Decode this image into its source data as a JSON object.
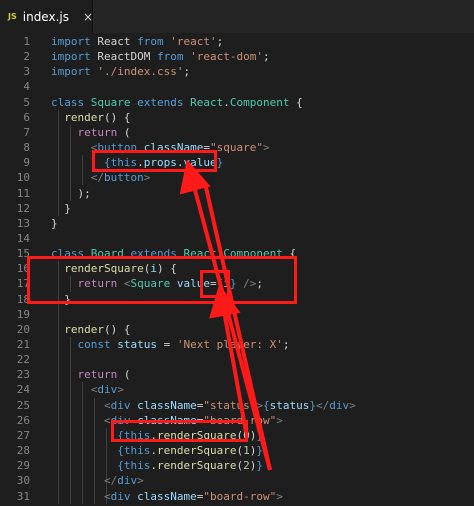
{
  "tab": {
    "icon": "JS",
    "filename": "index.js",
    "close": "×"
  },
  "colors": {
    "annotation": "#ff1a1a",
    "background": "#1e1e1e"
  },
  "lines": [
    {
      "n": "1",
      "tokens": [
        [
          "kw",
          "import "
        ],
        [
          "txt",
          "React "
        ],
        [
          "kw",
          "from "
        ],
        [
          "str",
          "'react'"
        ],
        [
          "txt",
          ";"
        ]
      ]
    },
    {
      "n": "2",
      "tokens": [
        [
          "kw",
          "import "
        ],
        [
          "txt",
          "ReactDOM "
        ],
        [
          "kw",
          "from "
        ],
        [
          "str",
          "'react-dom'"
        ],
        [
          "txt",
          ";"
        ]
      ]
    },
    {
      "n": "3",
      "tokens": [
        [
          "kw",
          "import "
        ],
        [
          "str",
          "'./index.css'"
        ],
        [
          "txt",
          ";"
        ]
      ]
    },
    {
      "n": "4",
      "tokens": []
    },
    {
      "n": "5",
      "tokens": [
        [
          "kw",
          "class "
        ],
        [
          "cls",
          "Square "
        ],
        [
          "kw",
          "extends "
        ],
        [
          "cls",
          "React"
        ],
        [
          "txt",
          "."
        ],
        [
          "cls",
          "Component "
        ],
        [
          "txt",
          "{"
        ]
      ]
    },
    {
      "n": "6",
      "tokens": [
        [
          "txt",
          "  "
        ],
        [
          "fn",
          "render"
        ],
        [
          "txt",
          "() {"
        ]
      ]
    },
    {
      "n": "7",
      "tokens": [
        [
          "txt",
          "    "
        ],
        [
          "ctl",
          "return "
        ],
        [
          "txt",
          "("
        ]
      ]
    },
    {
      "n": "8",
      "tokens": [
        [
          "txt",
          "      "
        ],
        [
          "punc",
          "<"
        ],
        [
          "tag",
          "button "
        ],
        [
          "attr",
          "className"
        ],
        [
          "txt",
          "="
        ],
        [
          "str",
          "\"square\""
        ],
        [
          "punc",
          ">"
        ]
      ]
    },
    {
      "n": "9",
      "tokens": [
        [
          "txt",
          "        "
        ],
        [
          "kw",
          "{"
        ],
        [
          "kw",
          "this"
        ],
        [
          "txt",
          "."
        ],
        [
          "var",
          "props"
        ],
        [
          "txt",
          "."
        ],
        [
          "var",
          "value"
        ],
        [
          "kw",
          "}"
        ]
      ]
    },
    {
      "n": "10",
      "tokens": [
        [
          "txt",
          "      "
        ],
        [
          "punc",
          "</"
        ],
        [
          "tag",
          "button"
        ],
        [
          "punc",
          ">"
        ]
      ]
    },
    {
      "n": "11",
      "tokens": [
        [
          "txt",
          "    );"
        ]
      ]
    },
    {
      "n": "12",
      "tokens": [
        [
          "txt",
          "  }"
        ]
      ]
    },
    {
      "n": "13",
      "tokens": [
        [
          "txt",
          "}"
        ]
      ]
    },
    {
      "n": "14",
      "tokens": []
    },
    {
      "n": "15",
      "tokens": [
        [
          "kw",
          "class "
        ],
        [
          "cls",
          "Board "
        ],
        [
          "kw",
          "extends "
        ],
        [
          "cls",
          "React"
        ],
        [
          "txt",
          "."
        ],
        [
          "cls",
          "Component "
        ],
        [
          "txt",
          "{"
        ]
      ]
    },
    {
      "n": "16",
      "tokens": [
        [
          "txt",
          "  "
        ],
        [
          "fn",
          "renderSquare"
        ],
        [
          "txt",
          "("
        ],
        [
          "var",
          "i"
        ],
        [
          "txt",
          ") {"
        ]
      ]
    },
    {
      "n": "17",
      "tokens": [
        [
          "txt",
          "    "
        ],
        [
          "ctl",
          "return "
        ],
        [
          "punc",
          "<"
        ],
        [
          "cls",
          "Square "
        ],
        [
          "attr",
          "value"
        ],
        [
          "txt",
          "="
        ],
        [
          "kw",
          "{"
        ],
        [
          "var",
          "i"
        ],
        [
          "kw",
          "}"
        ],
        [
          "punc",
          " />"
        ],
        [
          "txt",
          ";"
        ]
      ]
    },
    {
      "n": "18",
      "tokens": [
        [
          "txt",
          "  }"
        ]
      ]
    },
    {
      "n": "19",
      "tokens": []
    },
    {
      "n": "20",
      "tokens": [
        [
          "txt",
          "  "
        ],
        [
          "fn",
          "render"
        ],
        [
          "txt",
          "() {"
        ]
      ]
    },
    {
      "n": "21",
      "tokens": [
        [
          "txt",
          "    "
        ],
        [
          "kw",
          "const "
        ],
        [
          "var",
          "status "
        ],
        [
          "txt",
          "= "
        ],
        [
          "str",
          "'Next player: X'"
        ],
        [
          "txt",
          ";"
        ]
      ]
    },
    {
      "n": "22",
      "tokens": []
    },
    {
      "n": "23",
      "tokens": [
        [
          "txt",
          "    "
        ],
        [
          "ctl",
          "return "
        ],
        [
          "txt",
          "("
        ]
      ]
    },
    {
      "n": "24",
      "tokens": [
        [
          "txt",
          "      "
        ],
        [
          "punc",
          "<"
        ],
        [
          "tag",
          "div"
        ],
        [
          "punc",
          ">"
        ]
      ]
    },
    {
      "n": "25",
      "tokens": [
        [
          "txt",
          "        "
        ],
        [
          "punc",
          "<"
        ],
        [
          "tag",
          "div "
        ],
        [
          "attr",
          "className"
        ],
        [
          "txt",
          "="
        ],
        [
          "str",
          "\"status\""
        ],
        [
          "punc",
          ">"
        ],
        [
          "kw",
          "{"
        ],
        [
          "var",
          "status"
        ],
        [
          "kw",
          "}"
        ],
        [
          "punc",
          "</"
        ],
        [
          "tag",
          "div"
        ],
        [
          "punc",
          ">"
        ]
      ]
    },
    {
      "n": "26",
      "tokens": [
        [
          "txt",
          "        "
        ],
        [
          "punc",
          "<"
        ],
        [
          "tag",
          "div "
        ],
        [
          "attr",
          "className"
        ],
        [
          "txt",
          "="
        ],
        [
          "str",
          "\"board-row\""
        ],
        [
          "punc",
          ">"
        ]
      ]
    },
    {
      "n": "27",
      "tokens": [
        [
          "txt",
          "          "
        ],
        [
          "kw",
          "{"
        ],
        [
          "kw",
          "this"
        ],
        [
          "txt",
          "."
        ],
        [
          "fn",
          "renderSquare"
        ],
        [
          "txt",
          "("
        ],
        [
          "num",
          "0"
        ],
        [
          "txt",
          ")"
        ],
        [
          "kw",
          "}"
        ]
      ]
    },
    {
      "n": "28",
      "tokens": [
        [
          "txt",
          "          "
        ],
        [
          "kw",
          "{"
        ],
        [
          "kw",
          "this"
        ],
        [
          "txt",
          "."
        ],
        [
          "fn",
          "renderSquare"
        ],
        [
          "txt",
          "("
        ],
        [
          "num",
          "1"
        ],
        [
          "txt",
          ")"
        ],
        [
          "kw",
          "}"
        ]
      ]
    },
    {
      "n": "29",
      "tokens": [
        [
          "txt",
          "          "
        ],
        [
          "kw",
          "{"
        ],
        [
          "kw",
          "this"
        ],
        [
          "txt",
          "."
        ],
        [
          "fn",
          "renderSquare"
        ],
        [
          "txt",
          "("
        ],
        [
          "num",
          "2"
        ],
        [
          "txt",
          ")"
        ],
        [
          "kw",
          "}"
        ]
      ]
    },
    {
      "n": "30",
      "tokens": [
        [
          "txt",
          "        "
        ],
        [
          "punc",
          "</"
        ],
        [
          "tag",
          "div"
        ],
        [
          "punc",
          ">"
        ]
      ]
    },
    {
      "n": "31",
      "tokens": [
        [
          "txt",
          "        "
        ],
        [
          "punc",
          "<"
        ],
        [
          "tag",
          "div "
        ],
        [
          "attr",
          "className"
        ],
        [
          "txt",
          "="
        ],
        [
          "str",
          "\"board-row\""
        ],
        [
          "punc",
          ">"
        ]
      ]
    }
  ]
}
